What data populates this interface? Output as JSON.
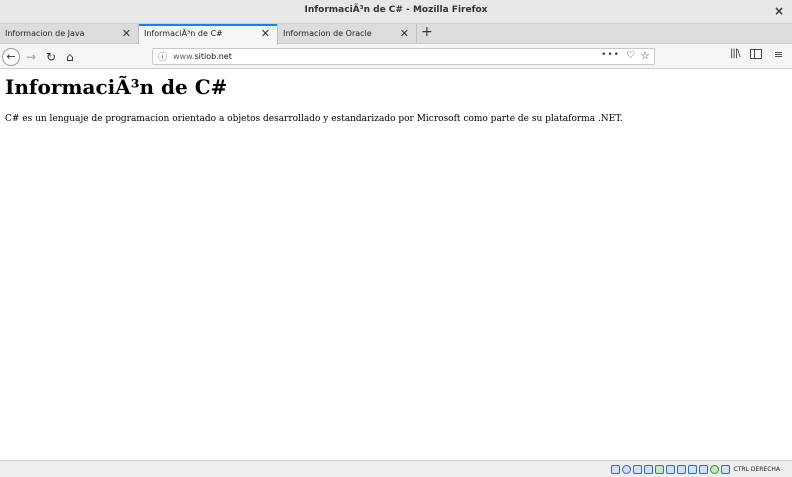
{
  "window": {
    "title": "InformaciÃ³n de C# - Mozilla Firefox",
    "close_glyph": "×"
  },
  "tabs": [
    {
      "label": "Informacion de Java",
      "close_glyph": "✕",
      "active": false
    },
    {
      "label": "InformaciÃ³n de C#",
      "close_glyph": "✕",
      "active": true
    },
    {
      "label": "Informacion de Oracle",
      "close_glyph": "✕",
      "active": false
    }
  ],
  "new_tab_glyph": "+",
  "nav": {
    "back_glyph": "←",
    "forward_glyph": "→",
    "reload_glyph": "↻",
    "home_glyph": "⌂",
    "info_glyph": "ⓘ",
    "url_prefix": "www.",
    "url_domain": "sitiob.net",
    "page_actions_glyph": "•••",
    "pocket_glyph": "♡",
    "bookmark_glyph": "☆",
    "library_glyph": "|||\\",
    "menu_glyph": "≡"
  },
  "page": {
    "heading": "InformaciÃ³n de C#",
    "paragraph": "C# es un lenguaje de programacion orientado a objetos desarrollado y estandarizado por Microsoft como parte de su plataforma .NET."
  },
  "statusbar": {
    "host_key_text": "CTRL DERECHA"
  },
  "colors": {
    "active_tab_accent": "#0a84ff"
  }
}
